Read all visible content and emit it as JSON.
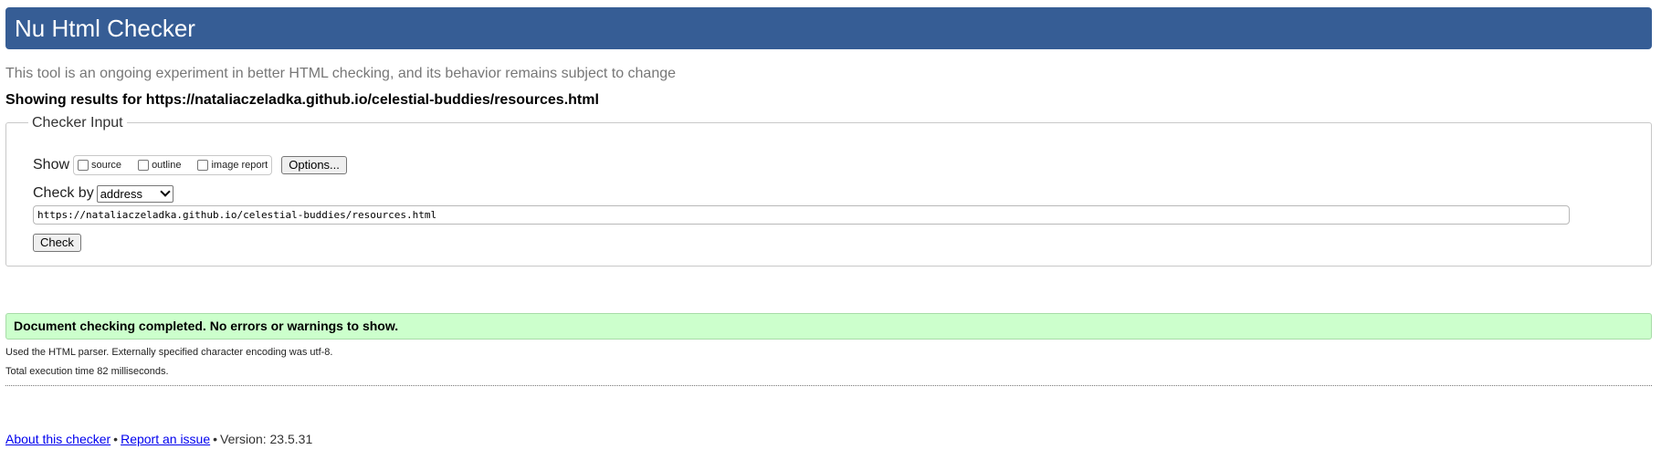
{
  "header": {
    "title": "Nu Html Checker"
  },
  "tagline": "This tool is an ongoing experiment in better HTML checking, and its behavior remains subject to change",
  "showing": {
    "text": "Showing results for https://nataliaczeladka.github.io/celestial-buddies/resources.html"
  },
  "checker_input": {
    "legend": "Checker Input",
    "show_label": "Show",
    "checkboxes": [
      {
        "label": "source",
        "checked": false
      },
      {
        "label": "outline",
        "checked": false
      },
      {
        "label": "image report",
        "checked": false
      }
    ],
    "options_label": "Options...",
    "check_by_label": "Check by",
    "check_by_value": "address",
    "url_value": "https://nataliaczeladka.github.io/celestial-buddies/resources.html",
    "check_label": "Check"
  },
  "result": {
    "message": "Document checking completed. No errors or warnings to show.",
    "parser_note": "Used the HTML parser. Externally specified character encoding was utf-8.",
    "time_note": "Total execution time 82 milliseconds."
  },
  "footer": {
    "about_link": "About this checker",
    "separator": "•",
    "report_link": "Report an issue",
    "version": "Version: 23.5.31"
  },
  "colors": {
    "header_bg": "#365d95",
    "success_bg": "#ccffcc",
    "link": "#0000ee"
  }
}
